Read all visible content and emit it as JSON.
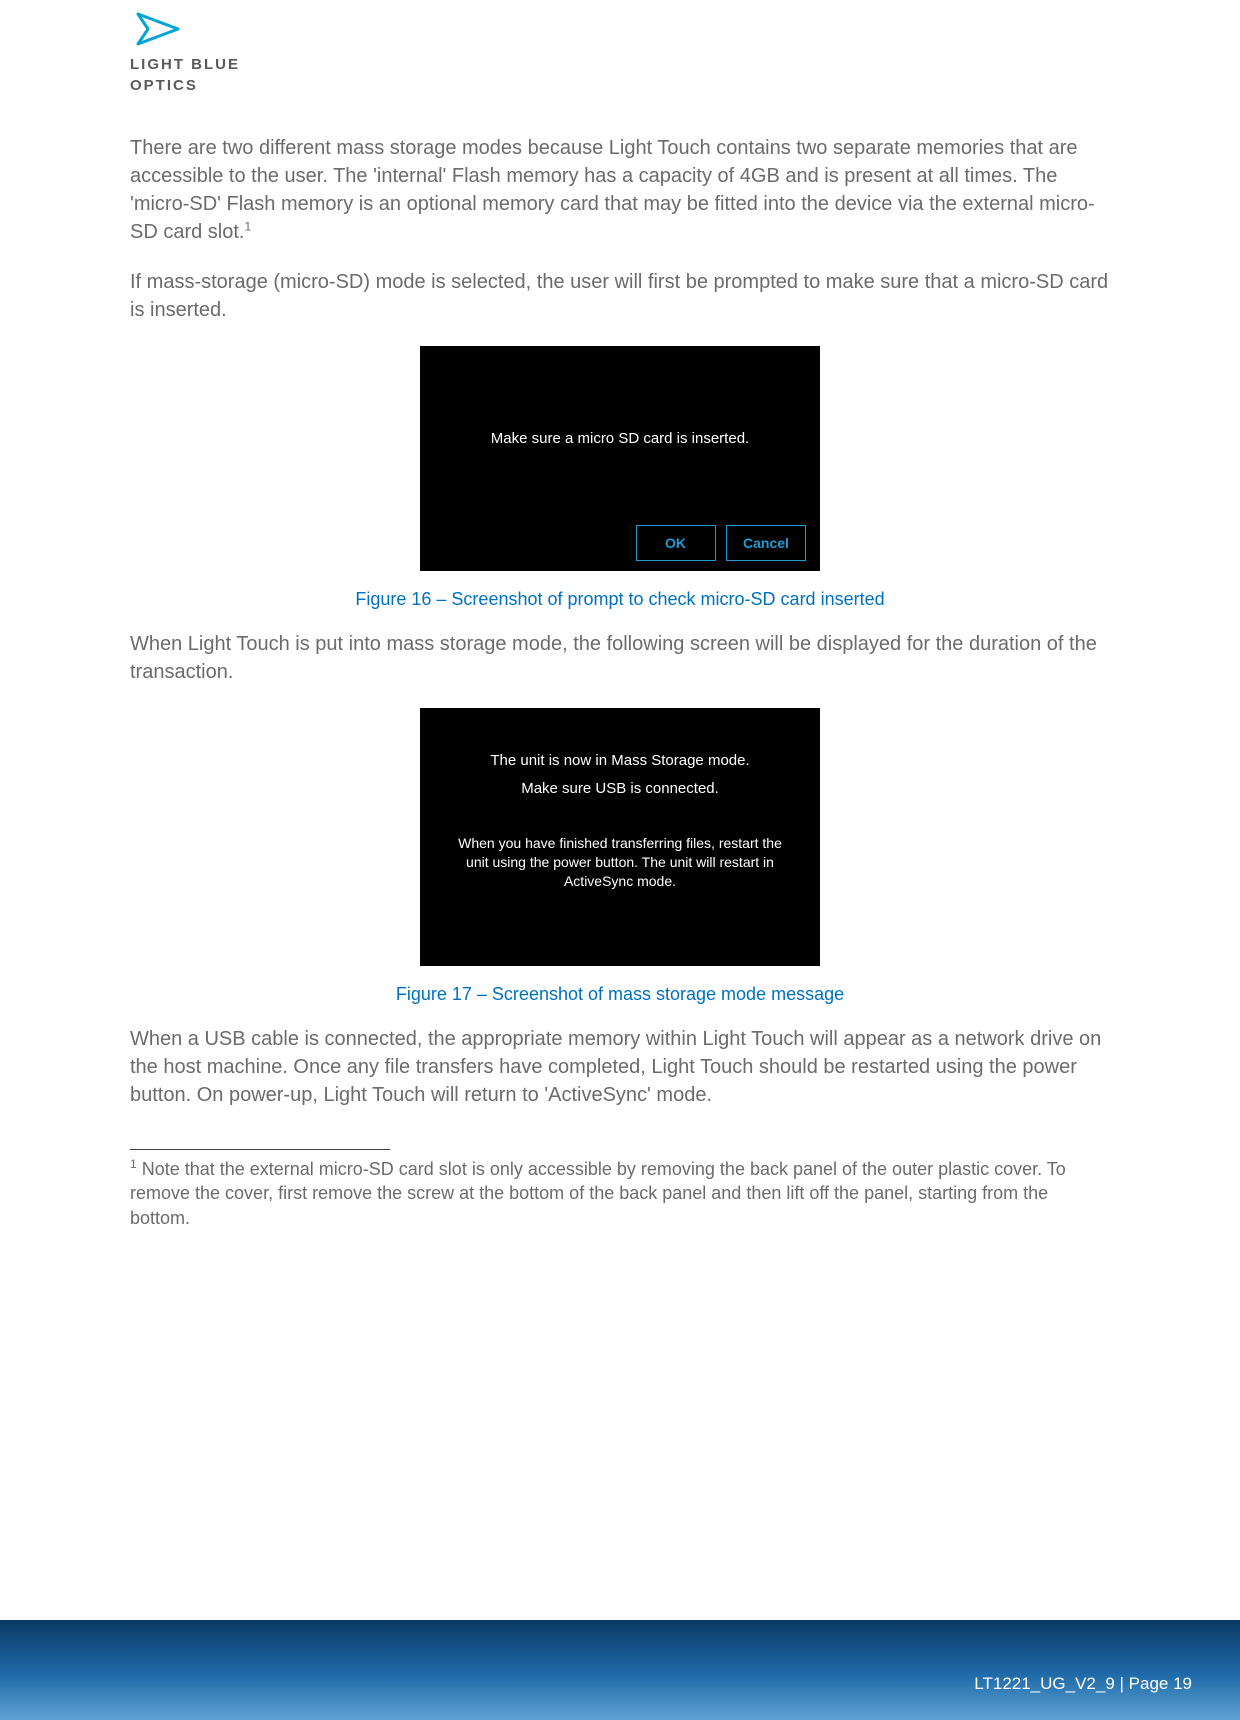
{
  "logo": {
    "line1": "LIGHT BLUE",
    "line2": "OPTICS"
  },
  "paragraphs": {
    "p1": "There are two different mass storage modes because Light Touch contains two separate memories that are accessible to the user. The 'internal' Flash memory has a capacity of 4GB and is present at all times. The 'micro-SD' Flash memory is an optional memory card that may be fitted into the device via the external micro-SD card slot.",
    "p1_sup": "1",
    "p2": "If mass-storage (micro-SD) mode is selected, the user will first be prompted to make sure that a micro-SD card is inserted.",
    "p3": "When Light Touch is put into mass storage mode, the following screen will be displayed for the duration of the transaction.",
    "p4": "When a USB cable is connected, the appropriate memory within Light Touch will appear as a network drive on the host machine. Once any file transfers have completed, Light Touch should be restarted using the power button. On power-up, Light Touch will return to 'ActiveSync' mode."
  },
  "screenshot1": {
    "message": "Make sure a micro SD card is inserted.",
    "ok": "OK",
    "cancel": "Cancel"
  },
  "caption1": "Figure 16 – Screenshot of prompt to check micro-SD card inserted",
  "screenshot2": {
    "line1": "The unit is now in Mass Storage mode.",
    "line2": "Make sure USB is connected.",
    "line3": "When you have finished transferring files, restart the unit using the power button. The unit will restart in ActiveSync mode."
  },
  "caption2": "Figure 17 – Screenshot of mass storage mode message",
  "footnote": {
    "marker": "1",
    "text": " Note that the external micro-SD card slot is only accessible by removing the back panel of the outer plastic cover. To remove the cover, first remove the screw at the bottom of the back panel and then lift off the panel, starting from the bottom."
  },
  "footer": "LT1221_UG_V2_9 | Page 19"
}
